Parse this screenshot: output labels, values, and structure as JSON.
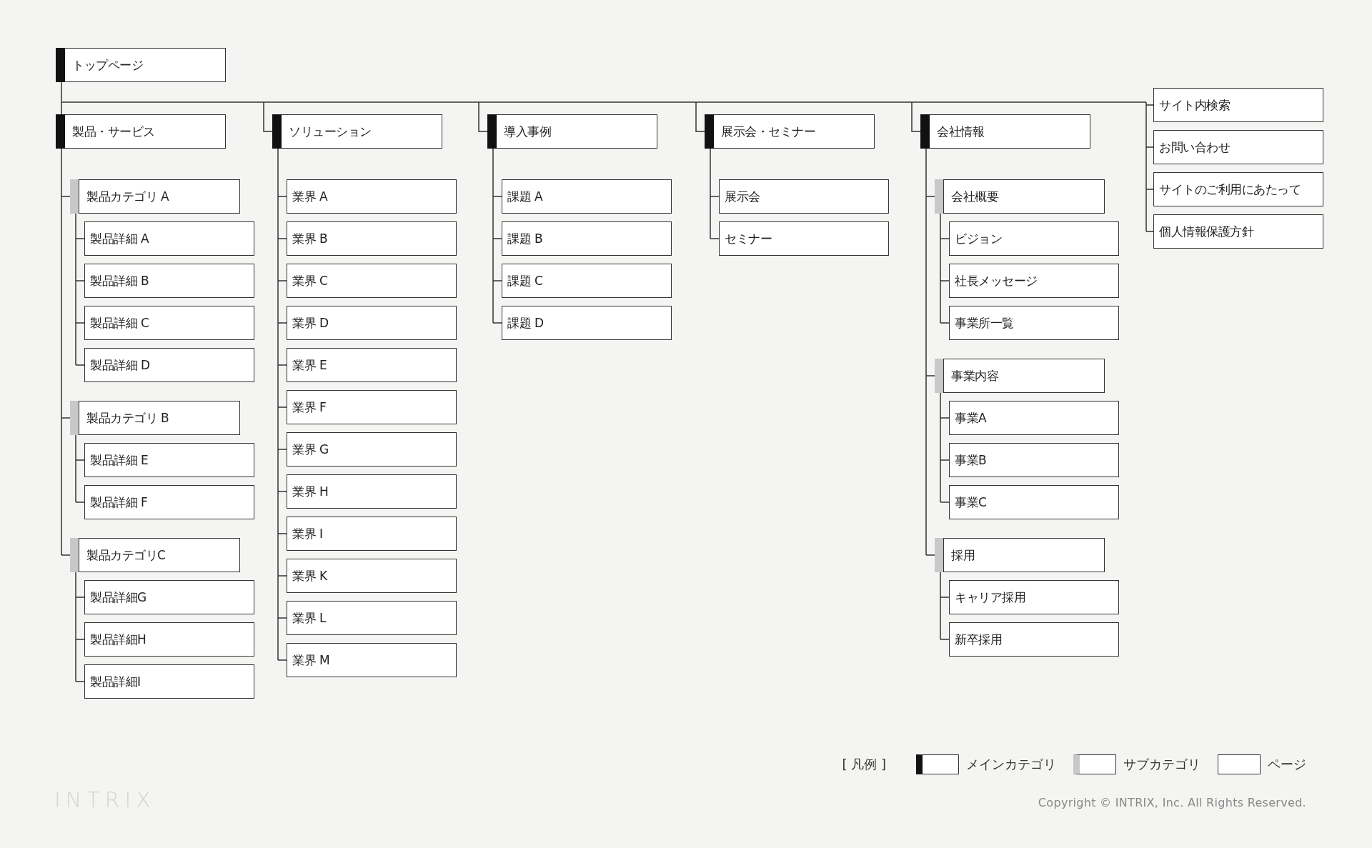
{
  "top_page": {
    "label": "トップページ",
    "kind": "main"
  },
  "sections": [
    {
      "label": "製品・サービス",
      "kind": "main",
      "children": [
        {
          "label": "製品カテゴリ A",
          "kind": "sub",
          "children": [
            {
              "label": "製品詳細 A",
              "kind": "page"
            },
            {
              "label": "製品詳細 B",
              "kind": "page"
            },
            {
              "label": "製品詳細 C",
              "kind": "page"
            },
            {
              "label": "製品詳細 D",
              "kind": "page"
            }
          ]
        },
        {
          "label": "製品カテゴリ B",
          "kind": "sub",
          "children": [
            {
              "label": "製品詳細 E",
              "kind": "page"
            },
            {
              "label": "製品詳細 F",
              "kind": "page"
            }
          ]
        },
        {
          "label": "製品カテゴリC",
          "kind": "sub",
          "children": [
            {
              "label": "製品詳細G",
              "kind": "page"
            },
            {
              "label": "製品詳細H",
              "kind": "page"
            },
            {
              "label": "製品詳細I",
              "kind": "page"
            }
          ]
        }
      ]
    },
    {
      "label": "ソリューション",
      "kind": "main",
      "children": [
        {
          "label": "業界 A",
          "kind": "page"
        },
        {
          "label": "業界 B",
          "kind": "page"
        },
        {
          "label": "業界 C",
          "kind": "page"
        },
        {
          "label": "業界 D",
          "kind": "page"
        },
        {
          "label": "業界 E",
          "kind": "page"
        },
        {
          "label": "業界 F",
          "kind": "page"
        },
        {
          "label": "業界 G",
          "kind": "page"
        },
        {
          "label": "業界 H",
          "kind": "page"
        },
        {
          "label": "業界 I",
          "kind": "page"
        },
        {
          "label": "業界 K",
          "kind": "page"
        },
        {
          "label": "業界 L",
          "kind": "page"
        },
        {
          "label": "業界 M",
          "kind": "page"
        }
      ]
    },
    {
      "label": "導入事例",
      "kind": "main",
      "children": [
        {
          "label": "課題 A",
          "kind": "page"
        },
        {
          "label": "課題 B",
          "kind": "page"
        },
        {
          "label": "課題 C",
          "kind": "page"
        },
        {
          "label": "課題 D",
          "kind": "page"
        }
      ]
    },
    {
      "label": "展示会・セミナー",
      "kind": "main",
      "children": [
        {
          "label": "展示会",
          "kind": "page"
        },
        {
          "label": "セミナー",
          "kind": "page"
        }
      ]
    },
    {
      "label": "会社情報",
      "kind": "main",
      "children": [
        {
          "label": "会社概要",
          "kind": "sub",
          "children": [
            {
              "label": "ビジョン",
              "kind": "page"
            },
            {
              "label": "社長メッセージ",
              "kind": "page"
            },
            {
              "label": "事業所一覧",
              "kind": "page"
            }
          ]
        },
        {
          "label": "事業内容",
          "kind": "sub",
          "children": [
            {
              "label": "事業A",
              "kind": "page"
            },
            {
              "label": "事業B",
              "kind": "page"
            },
            {
              "label": "事業C",
              "kind": "page"
            }
          ]
        },
        {
          "label": "採用",
          "kind": "sub",
          "children": [
            {
              "label": "キャリア採用",
              "kind": "page"
            },
            {
              "label": "新卒採用",
              "kind": "page"
            }
          ]
        }
      ]
    }
  ],
  "utility_pages": [
    {
      "label": "サイト内検索",
      "kind": "page"
    },
    {
      "label": "お問い合わせ",
      "kind": "page"
    },
    {
      "label": "サイトのご利用にあたって",
      "kind": "page"
    },
    {
      "label": "個人情報保護方針",
      "kind": "page"
    }
  ],
  "legend": {
    "title": "[ 凡例 ]",
    "items": [
      {
        "kind": "main",
        "label": "メインカテゴリ"
      },
      {
        "kind": "sub",
        "label": "サブカテゴリ"
      },
      {
        "kind": "page",
        "label": "ページ"
      }
    ]
  },
  "logo": "INTRIX",
  "copyright": "Copyright © INTRIX, Inc. All Rights Reserved."
}
